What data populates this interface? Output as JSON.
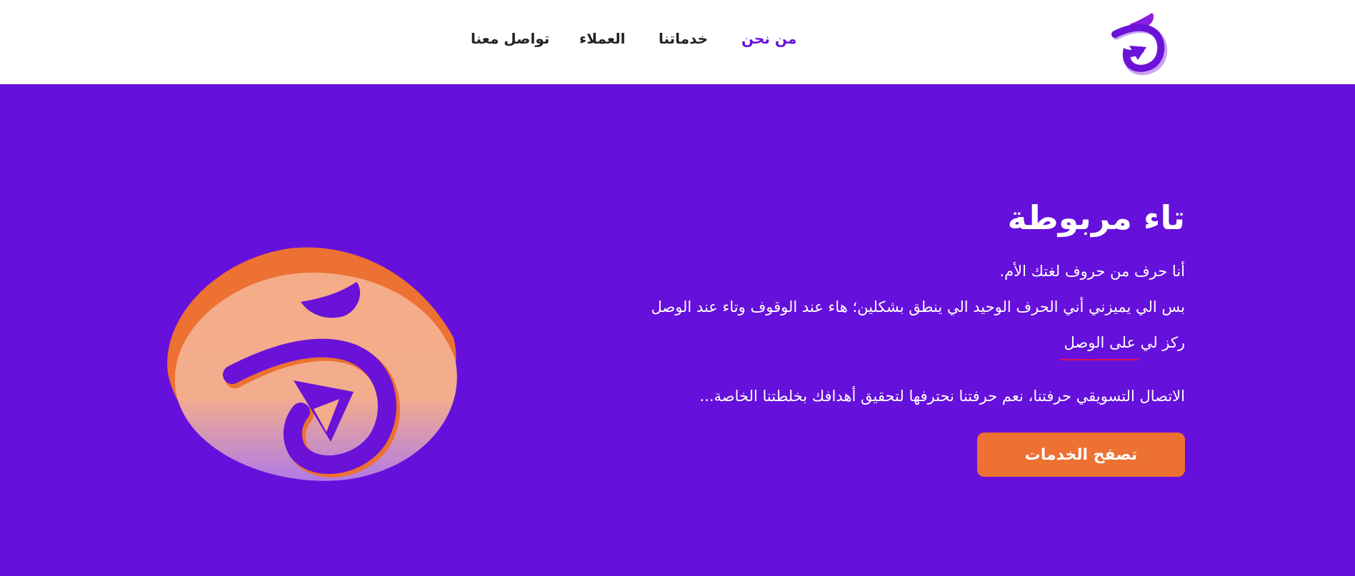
{
  "header": {
    "nav": [
      {
        "label": "من نحن",
        "active": true
      },
      {
        "label": "خدماتنا",
        "active": false
      },
      {
        "label": "العملاء",
        "active": false
      },
      {
        "label": "تواصل معنا",
        "active": false
      }
    ],
    "logo_icon": "letter-ta-marbuta-logo"
  },
  "hero": {
    "title": "تاء مربوطة",
    "line1": "أنا حرف من حروف لغتك الأم.",
    "line2": "بس الي يميزني أني الحرف الوحيد الي ينطق بشكلين؛ هاء عند الوقوف وتاء عند الوصل",
    "line3": "ركز لي على الوصل",
    "line4": "الاتصال التسويقي حرفتنا، نعم حرفتنا نحترفها لتحقيق أهدافك بخلطتنا الخاصة...",
    "cta_label": "تصفح الخدمات",
    "illustration_icon": "ta-marbuta-blob-icon"
  },
  "colors": {
    "primary": "#6610db",
    "accent": "#ec7132",
    "underline": "#e0104f",
    "header_bg": "#ffffff"
  }
}
